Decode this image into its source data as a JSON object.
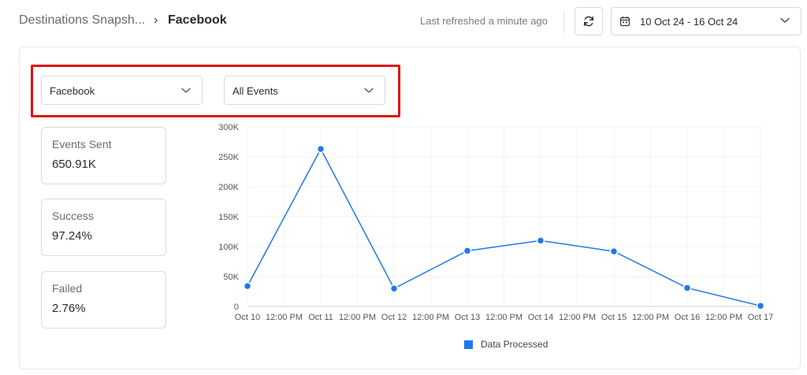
{
  "breadcrumb": {
    "parent": "Destinations Snapsh...",
    "separator": "›",
    "current": "Facebook"
  },
  "header": {
    "refreshed": "Last refreshed a minute ago",
    "date_range": "10 Oct 24 - 16 Oct 24"
  },
  "icons": {
    "refresh": "refresh-icon",
    "calendar": "calendar-icon",
    "chevron": "chevron-down-icon"
  },
  "filters": {
    "destination": "Facebook",
    "events": "All Events"
  },
  "stats": [
    {
      "label": "Events Sent",
      "value": "650.91K"
    },
    {
      "label": "Success",
      "value": "97.24%"
    },
    {
      "label": "Failed",
      "value": "2.76%"
    }
  ],
  "colors": {
    "series": "#1f78f0",
    "highlight": "#e01010"
  },
  "chart_data": {
    "type": "line",
    "x_ticks": [
      "Oct 10",
      "12:00 PM",
      "Oct 11",
      "12:00 PM",
      "Oct 12",
      "12:00 PM",
      "Oct 13",
      "12:00 PM",
      "Oct 14",
      "12:00 PM",
      "Oct 15",
      "12:00 PM",
      "Oct 16",
      "12:00 PM",
      "Oct 17"
    ],
    "y_ticks": [
      "0",
      "50K",
      "100K",
      "150K",
      "200K",
      "250K",
      "300K"
    ],
    "ylim": [
      0,
      300000
    ],
    "series": [
      {
        "name": "Data Processed",
        "x": [
          "Oct 10",
          "Oct 11",
          "Oct 12",
          "Oct 13",
          "Oct 14",
          "Oct 15",
          "Oct 16",
          "Oct 17"
        ],
        "values": [
          34000,
          263000,
          30000,
          93000,
          110000,
          92000,
          31000,
          1000
        ]
      }
    ],
    "legend": "bottom",
    "grid": true
  }
}
